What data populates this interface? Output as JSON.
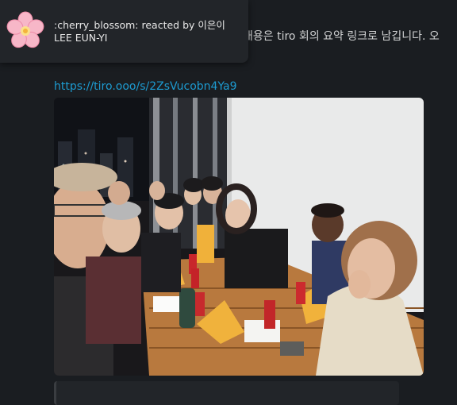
{
  "message": {
    "text": "내용은 tiro 회의 요약 링크로 남깁니다. 오",
    "link": "https://tiro.ooo/s/2ZsVucobn4Ya9"
  },
  "reaction_tooltip": {
    "line1": ":cherry_blossom: reacted by 이은이",
    "line2": "LEE EUN-YI",
    "emoji_icon": "cherry-blossom-icon"
  },
  "photo": {
    "icon": "group-dinner-photo"
  },
  "colors": {
    "background": "#1a1d21",
    "link": "#1d9bd1",
    "tooltip": "#222529"
  }
}
